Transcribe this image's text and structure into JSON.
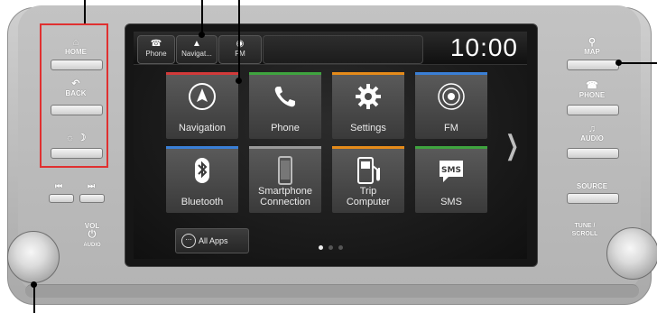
{
  "top_bar": {
    "phone_label": "Phone",
    "nav_label": "Navigat...",
    "fm_label": "FM",
    "clock": "10:00"
  },
  "apps": [
    {
      "label": "Navigation",
      "icon": "navigation-arrow-icon",
      "accent": "#d23a3a"
    },
    {
      "label": "Phone",
      "icon": "phone-icon",
      "accent": "#3fa43f"
    },
    {
      "label": "Settings",
      "icon": "gear-icon",
      "accent": "#e58b1a"
    },
    {
      "label": "FM",
      "icon": "radio-antenna-icon",
      "accent": "#3a7fd6"
    },
    {
      "label": "Bluetooth",
      "icon": "bluetooth-icon",
      "accent": "#3a7fd6"
    },
    {
      "label": "Smartphone\nConnection",
      "icon": "smartphone-icon",
      "accent": "#9a9a9a"
    },
    {
      "label": "Trip\nComputer",
      "icon": "fuel-pump-icon",
      "accent": "#e58b1a"
    },
    {
      "label": "SMS",
      "icon": "sms-bubble-icon",
      "accent": "#3fa43f"
    }
  ],
  "all_apps_label": "All Apps",
  "pager_current": 1,
  "left_panel": {
    "home": "HOME",
    "back": "BACK",
    "skip_back": "⏮",
    "skip_forward": "⏭",
    "vol": "VOL",
    "audio": "AUDIO"
  },
  "right_panel": {
    "map": "MAP",
    "phone": "PHONE",
    "audio": "AUDIO",
    "source": "SOURCE",
    "tune_scroll": "TUNE /\nSCROLL"
  },
  "colors": {
    "highlight": "#e03030"
  }
}
